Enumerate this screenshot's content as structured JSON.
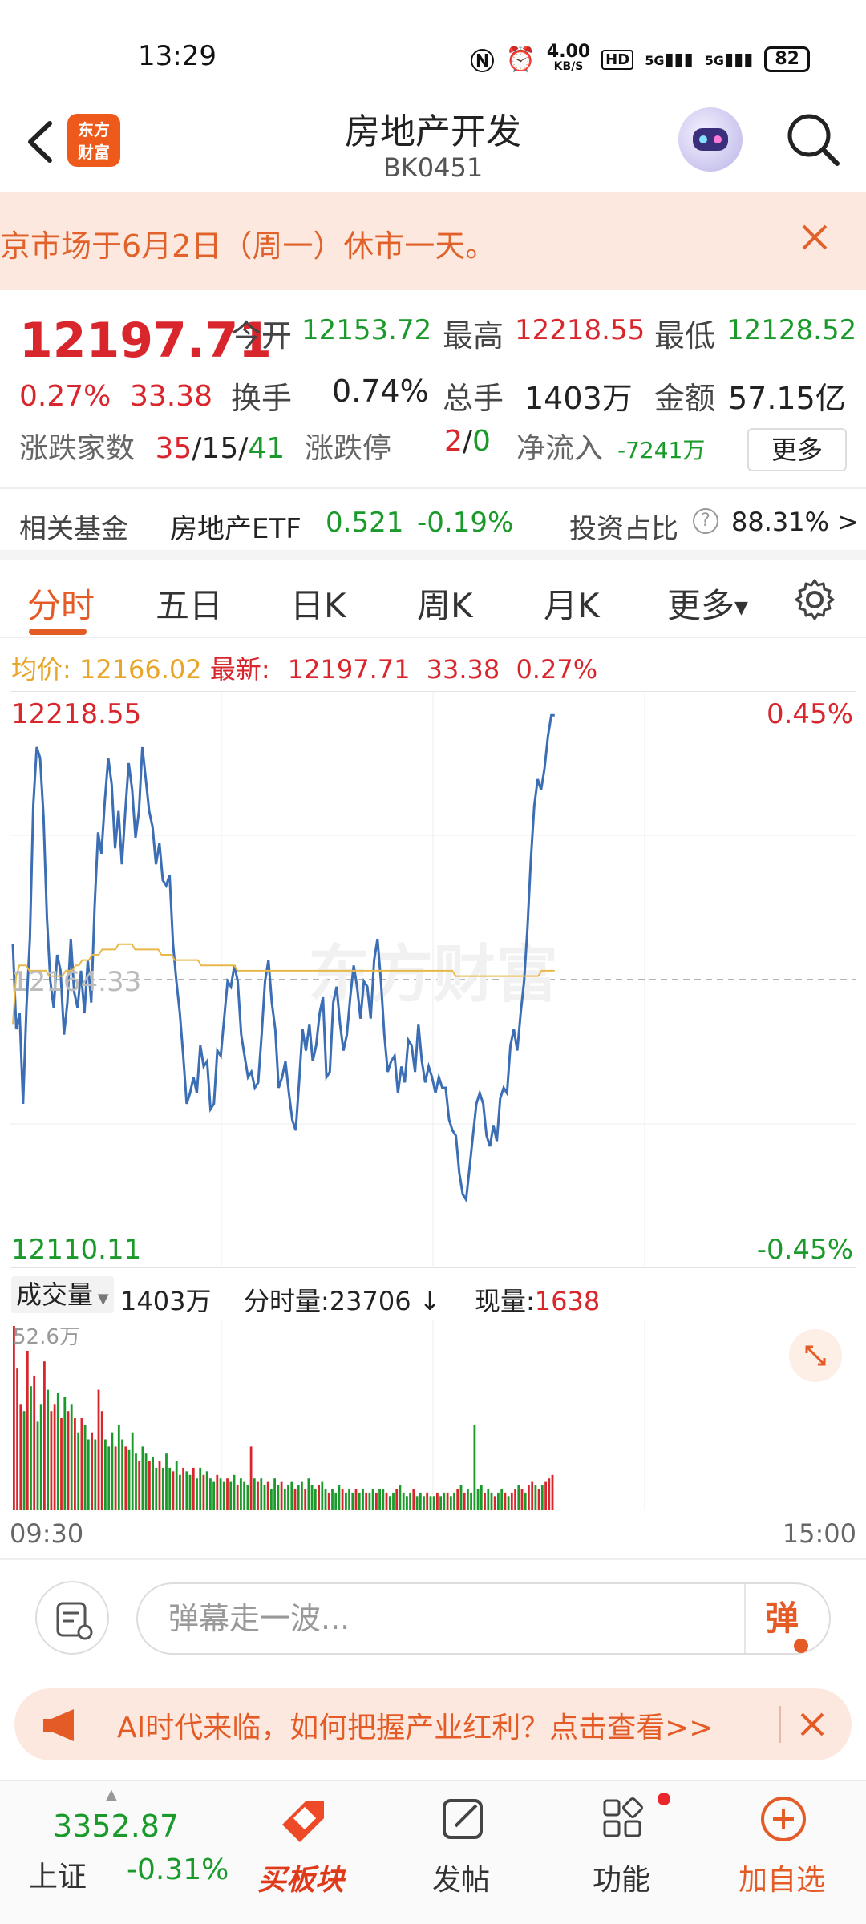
{
  "status_bar": {
    "time": "13:29",
    "net_speed": "4.00",
    "net_unit": "KB/S",
    "signal1": "5G",
    "signal2": "5G",
    "battery": "82"
  },
  "header": {
    "logo_top": "东方",
    "logo_bottom": "财富",
    "title": "房地产开发",
    "code": "BK0451"
  },
  "notice": {
    "text": "京市场于6月2日（周一）休市一天。"
  },
  "quote": {
    "price": "12197.71",
    "change_pct": "0.27%",
    "change_val": "33.38",
    "open_label": "今开",
    "open_val": "12153.72",
    "high_label": "最高",
    "high_val": "12218.55",
    "low_label": "最低",
    "low_val": "12128.52",
    "turnover_label": "换手",
    "turnover_val": "0.74%",
    "volume_label": "总手",
    "volume_val": "1403万",
    "amount_label": "金额",
    "amount_val": "57.15亿",
    "updown_label": "涨跌家数",
    "up_count": "35",
    "flat_count": "15",
    "down_count": "41",
    "limit_label": "涨跌停",
    "limit_up": "2",
    "limit_down": "0",
    "inflow_label": "净流入",
    "inflow_val": "-7241万",
    "more_label": "更多",
    "slash": "/"
  },
  "funds": {
    "label": "相关基金",
    "fund_name": "房地产ETF",
    "fund_price": "0.521",
    "fund_change": "-0.19%",
    "ratio_label": "投资占比",
    "ratio_val": "88.31% >"
  },
  "tabs": [
    {
      "label": "分时"
    },
    {
      "label": "五日"
    },
    {
      "label": "日K"
    },
    {
      "label": "周K"
    },
    {
      "label": "月K"
    },
    {
      "label": "更多"
    }
  ],
  "avg_row": {
    "avg_label": "均价:",
    "avg_val": "12166.02",
    "latest_label": "最新:",
    "latest_val": "12197.71",
    "latest_change": "33.38",
    "latest_pct": "0.27%"
  },
  "chart_data": {
    "type": "line",
    "y_top_label": "12218.55",
    "y_mid_label": "12164.33",
    "y_bottom_label": "12110.11",
    "pct_top_label": "0.45%",
    "pct_bottom_label": "-0.45%",
    "ylim": [
      12110.11,
      12218.55
    ],
    "prev_close": 12164.33,
    "x_start": "09:30",
    "x_end": "15:00",
    "watermark": "东方财富",
    "series": [
      {
        "values": [
          12171,
          12155,
          12158,
          12141,
          12159,
          12172,
          12197,
          12208,
          12206,
          12195,
          12176,
          12164,
          12159,
          12169,
          12166,
          12154,
          12160,
          12172,
          12162,
          12159,
          12166,
          12158,
          12168,
          12160,
          12178,
          12192,
          12188,
          12198,
          12206,
          12201,
          12189,
          12196,
          12186,
          12196,
          12205,
          12200,
          12191,
          12196,
          12208,
          12202,
          12196,
          12193,
          12186,
          12190,
          12183,
          12182,
          12184,
          12171,
          12164,
          12158,
          12150,
          12141,
          12143,
          12146,
          12143,
          12152,
          12148,
          12149,
          12140,
          12141,
          12151,
          12150,
          12157,
          12164,
          12163,
          12167,
          12164,
          12154,
          12150,
          12146,
          12147,
          12144,
          12145,
          12154,
          12164,
          12168,
          12160,
          12155,
          12144,
          12146,
          12149,
          12143,
          12138,
          12136,
          12145,
          12155,
          12151,
          12156,
          12149,
          12152,
          12158,
          12161,
          12146,
          12147,
          12160,
          12163,
          12156,
          12151,
          12154,
          12161,
          12167,
          12163,
          12157,
          12164,
          12163,
          12157,
          12168,
          12172,
          12164,
          12154,
          12147,
          12149,
          12150,
          12143,
          12148,
          12145,
          12153,
          12152,
          12147,
          12156,
          12149,
          12145,
          12148,
          12146,
          12143,
          12146,
          12144,
          12144,
          12138,
          12136,
          12135,
          12128,
          12124,
          12123,
          12129,
          12135,
          12141,
          12143,
          12141,
          12135,
          12133,
          12137,
          12134,
          12142,
          12144,
          12143,
          12152,
          12155,
          12151,
          12158,
          12164,
          12174,
          12187,
          12197,
          12202,
          12200,
          12204,
          12210,
          12214,
          12214
        ]
      },
      {
        "values": [
          12156,
          12165,
          12167,
          12167,
          12167,
          12166,
          12166,
          12166,
          12166,
          12166,
          12166,
          12165,
          12165,
          12165,
          12165,
          12165,
          12166,
          12166,
          12166,
          12167,
          12167,
          12168,
          12168,
          12168,
          12169,
          12169,
          12169,
          12170,
          12170,
          12170,
          12170,
          12170,
          12171,
          12171,
          12171,
          12171,
          12171,
          12170,
          12170,
          12170,
          12170,
          12170,
          12170,
          12170,
          12170,
          12169,
          12169,
          12169,
          12169,
          12168,
          12168,
          12168,
          12168,
          12168,
          12168,
          12168,
          12168,
          12167,
          12167,
          12167,
          12167,
          12167,
          12167,
          12167,
          12167,
          12167,
          12167,
          12167,
          12166,
          12166,
          12166,
          12166,
          12166,
          12166,
          12166,
          12166,
          12166,
          12166,
          12166,
          12166,
          12166,
          12166,
          12166,
          12166,
          12166,
          12166,
          12166,
          12166,
          12166,
          12166,
          12166,
          12166,
          12166,
          12166,
          12166,
          12166,
          12166,
          12166,
          12166,
          12166,
          12166,
          12166,
          12166,
          12166,
          12166,
          12166,
          12166,
          12166,
          12166,
          12166,
          12166,
          12166,
          12166,
          12166,
          12166,
          12166,
          12166,
          12166,
          12166,
          12166,
          12166,
          12166,
          12166,
          12166,
          12166,
          12166,
          12166,
          12166,
          12166,
          12166,
          12166,
          12166,
          12166,
          12166,
          12165,
          12165,
          12165,
          12165,
          12165,
          12165,
          12165,
          12165,
          12165,
          12165,
          12165,
          12165,
          12165,
          12165,
          12165,
          12165,
          12165,
          12165,
          12165,
          12165,
          12165,
          12165,
          12165,
          12165,
          12165,
          12165,
          12166,
          12166,
          12166,
          12166,
          12166
        ]
      }
    ]
  },
  "volume": {
    "selector_label": "成交量",
    "total": "1403万",
    "per_minute_label": "分时量:",
    "per_minute_val": "23706",
    "current_label": "现量:",
    "current_val": "1638",
    "max_label": "52.6万",
    "bars": [
      52,
      40,
      30,
      28,
      45,
      35,
      38,
      25,
      30,
      42,
      34,
      28,
      30,
      33,
      26,
      32,
      28,
      30,
      26,
      22,
      26,
      24,
      20,
      22,
      20,
      34,
      28,
      20,
      18,
      22,
      18,
      24,
      20,
      18,
      17,
      22,
      16,
      14,
      18,
      16,
      14,
      15,
      12,
      14,
      12,
      16,
      12,
      11,
      14,
      10,
      12,
      11,
      10,
      12,
      9,
      12,
      10,
      11,
      9,
      8,
      10,
      9,
      8,
      9,
      8,
      10,
      7,
      9,
      8,
      7,
      18,
      9,
      8,
      9,
      7,
      8,
      6,
      9,
      7,
      8,
      6,
      7,
      8,
      6,
      7,
      8,
      6,
      9,
      7,
      6,
      7,
      8,
      6,
      5,
      6,
      5,
      7,
      6,
      5,
      6,
      5,
      6,
      5,
      6,
      5,
      5,
      6,
      5,
      6,
      6,
      5,
      4,
      5,
      6,
      7,
      5,
      4,
      5,
      6,
      4,
      5,
      4,
      5,
      4,
      4,
      5,
      4,
      5,
      5,
      4,
      5,
      6,
      7,
      5,
      6,
      5,
      24,
      6,
      7,
      5,
      6,
      5,
      4,
      5,
      6,
      5,
      4,
      5,
      6,
      7,
      6,
      5,
      7,
      8,
      7,
      6,
      7,
      8,
      9,
      10
    ],
    "bar_colors": [
      "r",
      "r",
      "r",
      "g",
      "r",
      "g",
      "r",
      "g",
      "g",
      "r",
      "g",
      "r",
      "r",
      "g",
      "r",
      "g",
      "r",
      "g",
      "r",
      "g",
      "r",
      "g",
      "g",
      "r",
      "g",
      "r",
      "r",
      "g",
      "g",
      "g",
      "r",
      "g",
      "g",
      "r",
      "g",
      "g",
      "g",
      "r",
      "g",
      "g",
      "r",
      "g",
      "g",
      "r",
      "g",
      "g",
      "g",
      "r",
      "g",
      "g",
      "r",
      "g",
      "g",
      "r",
      "g",
      "g",
      "r",
      "g",
      "g",
      "g",
      "r",
      "g",
      "g",
      "r",
      "g",
      "g",
      "r",
      "g",
      "g",
      "g",
      "r",
      "g",
      "r",
      "g",
      "g",
      "r",
      "g",
      "g",
      "g",
      "r",
      "g",
      "g",
      "g",
      "r",
      "g",
      "g",
      "r",
      "g",
      "g",
      "g",
      "r",
      "g",
      "g",
      "r",
      "g",
      "g",
      "g",
      "r",
      "g",
      "g",
      "g",
      "r",
      "g",
      "g",
      "r",
      "g",
      "g",
      "r",
      "g",
      "g",
      "r",
      "g",
      "g",
      "r",
      "g",
      "g",
      "g",
      "g",
      "r",
      "g",
      "g",
      "g",
      "r",
      "g",
      "g",
      "r",
      "g",
      "g",
      "r",
      "g",
      "g",
      "r",
      "g",
      "r",
      "g",
      "g",
      "g",
      "g",
      "g",
      "r",
      "g",
      "g",
      "r",
      "g",
      "g",
      "r",
      "g",
      "r",
      "r",
      "g",
      "r",
      "g",
      "r",
      "r",
      "g",
      "r",
      "g",
      "r",
      "r",
      "r"
    ]
  },
  "time_axis": {
    "start": "09:30",
    "end": "15:00"
  },
  "comment": {
    "placeholder": "弹幕走一波...",
    "danmu_label": "弹"
  },
  "ad": {
    "text": "AI时代来临，如何把握产业红利？点击查看>>"
  },
  "bottom_nav": {
    "index_price": "3352.87",
    "index_name": "上证",
    "index_change": "-0.31%",
    "buy_label": "买板块",
    "post_label": "发帖",
    "func_label": "功能",
    "watch_label": "加自选"
  },
  "colors": {
    "up": "#d9262c",
    "down": "#1a9a2a",
    "accent": "#e55b26",
    "price_line": "#3b6eb4",
    "avg_line": "#e8b84a"
  }
}
